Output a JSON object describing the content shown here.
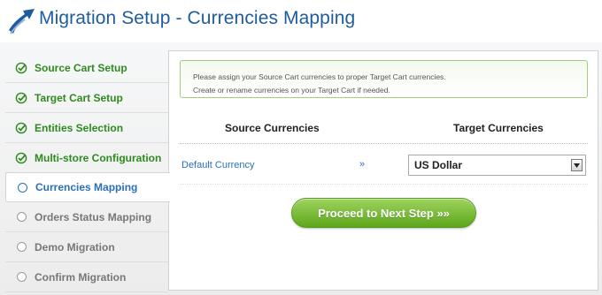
{
  "header": {
    "title": "Migration Setup - Currencies Mapping",
    "logo_icon": "migration-arrow-logo"
  },
  "sidebar": {
    "steps": [
      {
        "label": "Source Cart Setup",
        "state": "done",
        "icon": "check-circle-icon"
      },
      {
        "label": "Target Cart Setup",
        "state": "done",
        "icon": "check-circle-icon"
      },
      {
        "label": "Entities Selection",
        "state": "done",
        "icon": "check-circle-icon"
      },
      {
        "label": "Multi-store Configuration",
        "state": "done",
        "icon": "check-circle-icon"
      },
      {
        "label": "Currencies Mapping",
        "state": "active",
        "icon": "circle-icon"
      },
      {
        "label": "Orders Status Mapping",
        "state": "pending",
        "icon": "circle-icon"
      },
      {
        "label": "Demo Migration",
        "state": "pending",
        "icon": "circle-icon"
      },
      {
        "label": "Confirm Migration",
        "state": "pending",
        "icon": "circle-icon"
      }
    ]
  },
  "main": {
    "notice_line1": "Please assign your Source Cart currencies to proper Target Cart currencies.",
    "notice_line2": "Create or rename currencies on your Target Cart if needed.",
    "source_header": "Source Currencies",
    "target_header": "Target Currencies",
    "mapping": {
      "source": "Default Currency",
      "arrow": "»",
      "target_selected": "US Dollar"
    },
    "proceed_label": "Proceed to Next Step »»"
  },
  "colors": {
    "title_blue": "#1f5c9e",
    "done_green": "#2f8a1f",
    "active_blue": "#2a6fb8",
    "pending_gray": "#777777",
    "button_green": "#6ab52a"
  }
}
